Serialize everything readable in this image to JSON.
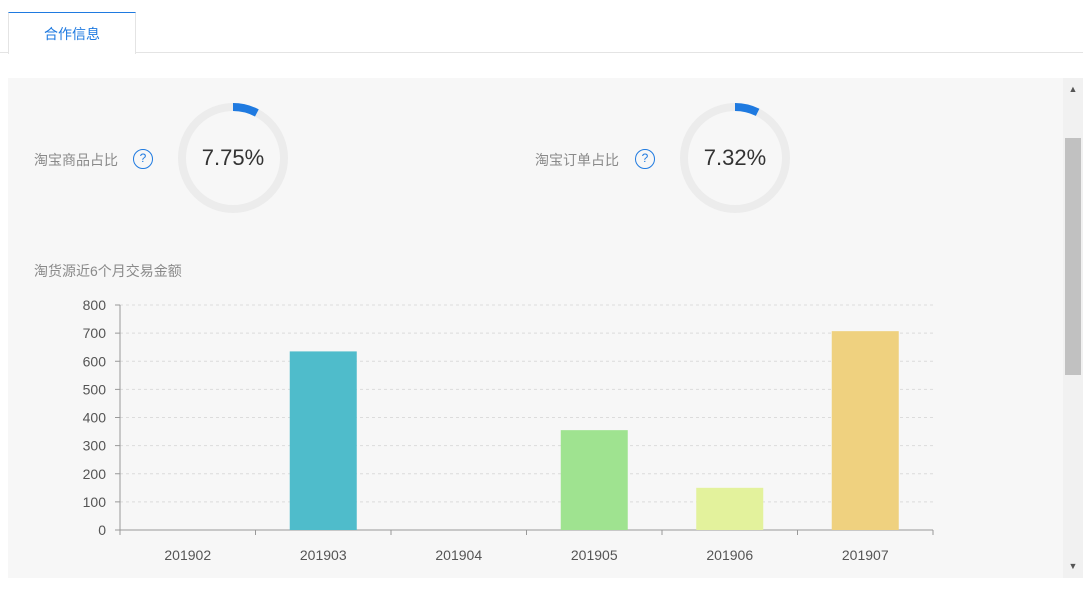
{
  "tabs": [
    {
      "label": "合作信息",
      "active": true
    }
  ],
  "metrics": [
    {
      "label": "淘宝商品占比",
      "value_text": "7.75%",
      "percent": 7.75,
      "help": "?"
    },
    {
      "label": "淘宝订单占比",
      "value_text": "7.32%",
      "percent": 7.32,
      "help": "?"
    }
  ],
  "colors": {
    "accent": "#1f7ae0",
    "gauge_track": "#ececec"
  },
  "chart_data": {
    "type": "bar",
    "title": "淘货源近6个月交易金额",
    "categories": [
      "201902",
      "201903",
      "201904",
      "201905",
      "201906",
      "201907"
    ],
    "values": [
      0,
      635,
      0,
      355,
      150,
      707
    ],
    "bar_colors": [
      "#4fbccb",
      "#4fbccb",
      "#4fbccb",
      "#9fe390",
      "#e3f29c",
      "#efd17f"
    ],
    "ylim": [
      0,
      800
    ],
    "yticks": [
      0,
      100,
      200,
      300,
      400,
      500,
      600,
      700,
      800
    ],
    "grid": true
  },
  "scrollbar": {
    "up_icon": "▲",
    "down_icon": "▼"
  }
}
